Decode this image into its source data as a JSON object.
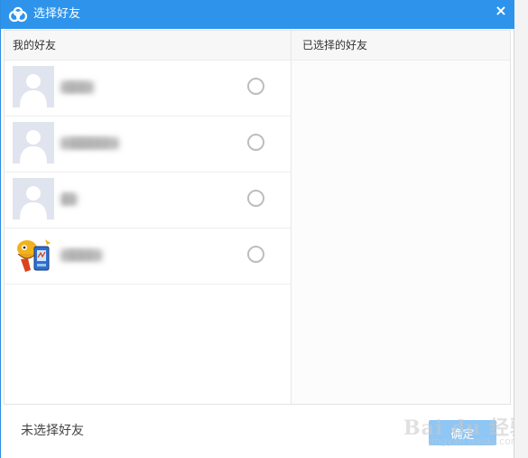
{
  "window": {
    "title": "选择好友",
    "close_label": "×",
    "accent_color": "#2e94eb"
  },
  "left_column": {
    "header": "我的好友",
    "friends": [
      {
        "name": "▇▇▇▇",
        "avatar": "default-avatar"
      },
      {
        "name": "▇▇▇▇▇▇▇",
        "avatar": "default-avatar"
      },
      {
        "name": "▇▇",
        "avatar": "default-avatar"
      },
      {
        "name": "▇▇▇▇▇",
        "avatar": "cartoon-avatar"
      }
    ]
  },
  "right_column": {
    "header": "已选择的好友"
  },
  "footer": {
    "status": "未选择好友",
    "confirm_label": "确定"
  },
  "watermark": {
    "brand": "Bai du 经验",
    "url": "jingyan.baidu.com"
  }
}
